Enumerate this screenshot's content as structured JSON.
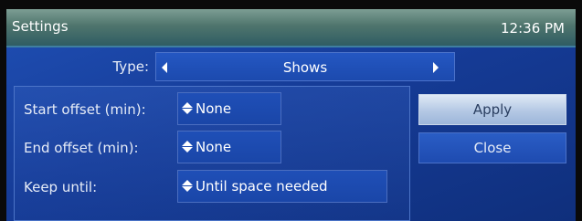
{
  "window": {
    "title": "Settings",
    "clock": "12:36 PM"
  },
  "type_selector": {
    "label": "Type:",
    "value": "Shows",
    "left_arrow_icon": "triangle-left-icon",
    "right_arrow_icon": "triangle-right-icon"
  },
  "rows": [
    {
      "label": "Start offset (min):",
      "value": "None",
      "icon": "up-down-spinner-icon"
    },
    {
      "label": "End offset (min):",
      "value": "None",
      "icon": "up-down-spinner-icon"
    },
    {
      "label": "Keep until:",
      "value": "Until space needed",
      "icon": "up-down-spinner-icon"
    }
  ],
  "buttons": {
    "apply": "Apply",
    "close": "Close"
  },
  "colors": {
    "background": "#163c98",
    "titlebar": "#4f756d",
    "apply_button": "#b4c8e4",
    "close_button": "#1e4bb0"
  }
}
